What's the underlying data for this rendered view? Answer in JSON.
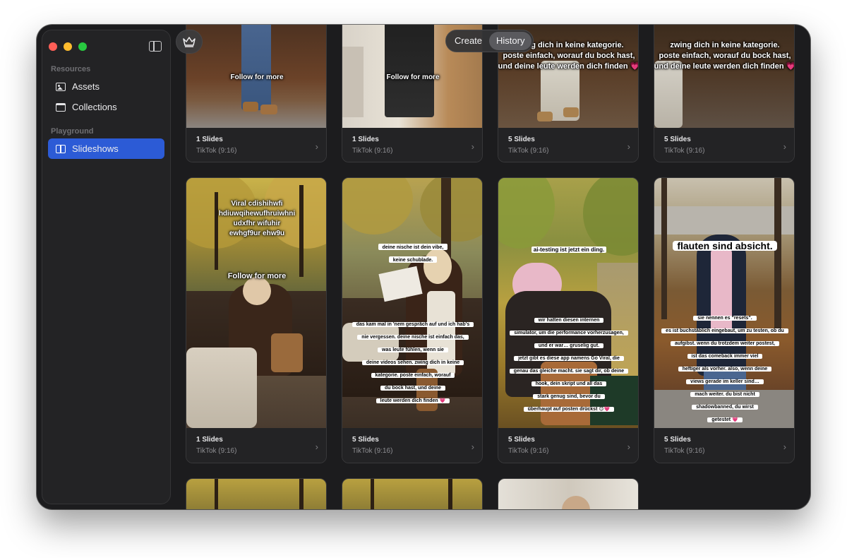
{
  "sidebar": {
    "sections": [
      {
        "title": "Resources",
        "items": [
          {
            "label": "Assets",
            "icon": "photo-icon"
          },
          {
            "label": "Collections",
            "icon": "folder-icon"
          }
        ]
      },
      {
        "title": "Playground",
        "items": [
          {
            "label": "Slideshows",
            "icon": "slideshow-icon",
            "active": true
          }
        ]
      }
    ]
  },
  "toolbar": {
    "crown_icon": "crown-icon",
    "tabs": [
      {
        "label": "Create",
        "active": false
      },
      {
        "label": "History",
        "active": true
      }
    ]
  },
  "cards": [
    {
      "title": "1 Slides",
      "subtitle": "TikTok (9:16)",
      "overlay": [
        "Follow for more"
      ]
    },
    {
      "title": "1 Slides",
      "subtitle": "TikTok (9:16)",
      "overlay": [
        "Follow for more"
      ]
    },
    {
      "title": "5 Slides",
      "subtitle": "TikTok (9:16)",
      "overlay": [
        "zwing dich in keine kategorie.",
        "poste einfach, worauf du bock hast,",
        "und deine leute werden dich finden 💗"
      ]
    },
    {
      "title": "5 Slides",
      "subtitle": "TikTok (9:16)",
      "overlay": [
        "zwing dich in keine kategorie.",
        "poste einfach, worauf du bock hast,",
        "und deine leute werden dich finden 💗"
      ]
    },
    {
      "title": "1 Slides",
      "subtitle": "TikTok (9:16)",
      "overlay": [
        "Viral cdishihwfi",
        "hdiuwqihewufhruiwhni",
        "udxfhr wifuhir",
        "ewhgf9ur ehw9u"
      ],
      "overlay2": "Follow for more"
    },
    {
      "title": "5 Slides",
      "subtitle": "TikTok (9:16)",
      "overlay": [
        "deine nische ist dein vibe,",
        "keine schublade."
      ],
      "overlay2": [
        "das kam mal in 'nem gespräch auf und ich hab's",
        "nie vergessen. deine nische ist einfach das,",
        "was leute fühlen, wenn sie",
        "deine videos sehen. zwing dich in keine",
        "kategorie. poste einfach, worauf",
        "du bock hast, und deine",
        "leute werden dich finden 💗"
      ]
    },
    {
      "title": "5 Slides",
      "subtitle": "TikTok (9:16)",
      "overlay": [
        "ai-testing ist jetzt ein ding."
      ],
      "overlay2": [
        "wir hatten diesen internen",
        "simulator, um die performance vorherzusagen,",
        "und er war… gruselig gut.",
        "jetzt gibt es diese app namens Go Viral, die",
        "genau das gleiche macht. sie sagt dir, ob deine",
        "hook, dein skript und all das",
        "stark genug sind, bevor du",
        "überhaupt auf posten drückst 😊💗"
      ]
    },
    {
      "title": "5 Slides",
      "subtitle": "TikTok (9:16)",
      "overlay": [
        "flauten sind absicht."
      ],
      "overlay2": [
        "sie nennen es \"resets\".",
        "es ist buchstäblich eingebaut, um zu testen, ob du",
        "aufgibst. wenn du trotzdem weiter postest,",
        "ist das comeback immer viel",
        "heftiger als vorher. also, wenn deine",
        "views gerade im keller sind…",
        "mach weiter. du bist nicht",
        "shadowbanned, du wirst",
        "getestet 💗"
      ]
    },
    {
      "title": "",
      "subtitle": ""
    },
    {
      "title": "",
      "subtitle": ""
    },
    {
      "title": "",
      "subtitle": ""
    }
  ],
  "chevron_icon": "chevron-right-icon",
  "colors": {
    "accent": "#2c5bd6",
    "window_bg": "#1c1c1e",
    "sidebar_bg": "#232325"
  }
}
